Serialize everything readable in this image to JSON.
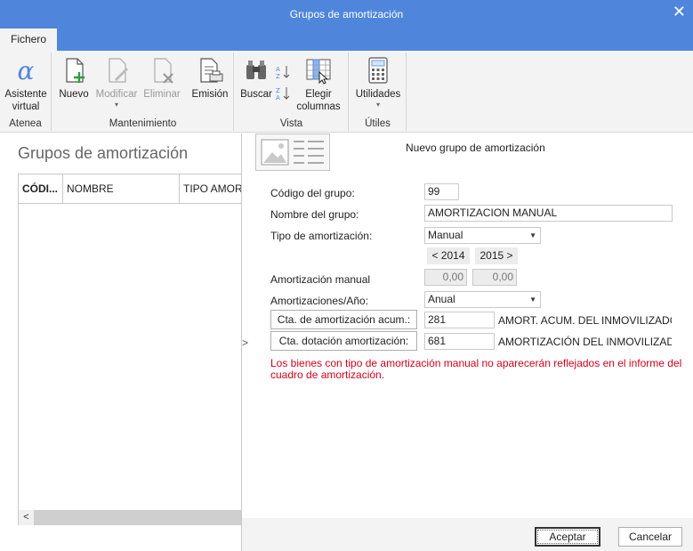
{
  "window": {
    "title": "Grupos de amortización",
    "close_glyph": "✕"
  },
  "tabs": {
    "fichero": "Fichero"
  },
  "ribbon": {
    "groups": {
      "atenea": "Atenea",
      "mantenimiento": "Mantenimiento",
      "vista": "Vista",
      "utiles": "Útiles"
    },
    "buttons": {
      "asistente_line1": "Asistente",
      "asistente_line2": "virtual",
      "nuevo": "Nuevo",
      "modificar": "Modificar",
      "eliminar": "Eliminar",
      "emision": "Emisión",
      "buscar": "Buscar",
      "elegir_line1": "Elegir",
      "elegir_line2": "columnas",
      "utilidades": "Utilidades"
    },
    "icons": [
      "alpha-icon",
      "new-document-icon",
      "edit-document-icon",
      "delete-document-icon",
      "print-document-icon",
      "binoculars-icon",
      "sort-az-icon",
      "sort-za-icon",
      "columns-icon",
      "calculator-icon"
    ]
  },
  "list": {
    "title": "Grupos de amortización",
    "columns": [
      "CÓDI...",
      "NOMBRE",
      "TIPO AMORT"
    ],
    "scroll_left": "<"
  },
  "form": {
    "title": "Nuevo grupo de amortización",
    "codigo_label": "Código del grupo:",
    "codigo_value": "99",
    "nombre_label": "Nombre del grupo:",
    "nombre_value": "AMORTIZACION MANUAL",
    "tipo_label": "Tipo de amortización:",
    "tipo_value": "Manual",
    "year_prev": "< 2014",
    "year_next": "2015 >",
    "manual_label": "Amortización manual",
    "manual_2014": "0,00",
    "manual_2015": "0,00",
    "anio_label": "Amortizaciones/Año:",
    "anio_value": "Anual",
    "cta_acum_label": "Cta. de amortización acum.:",
    "cta_acum_value": "281",
    "cta_acum_desc": "AMORT. ACUM. DEL INMOVILIZADO M",
    "cta_dot_label": "Cta. dotación amortización:",
    "cta_dot_value": "681",
    "cta_dot_desc": "AMORTIZACIÓN DEL INMOVILIZADO M",
    "warning_line1": "Los bienes con tipo de amortización manual no aparecerán reflejados en el informe del",
    "warning_line2": "cuadro de amortización.",
    "expander": ">"
  },
  "footer": {
    "accept": "Aceptar",
    "cancel": "Cancelar"
  },
  "colors": {
    "titlebar": "#4f86dc",
    "ribbon": "#f3f3f3",
    "warning": "#d0021b",
    "accent_green": "#2e9e3e"
  }
}
